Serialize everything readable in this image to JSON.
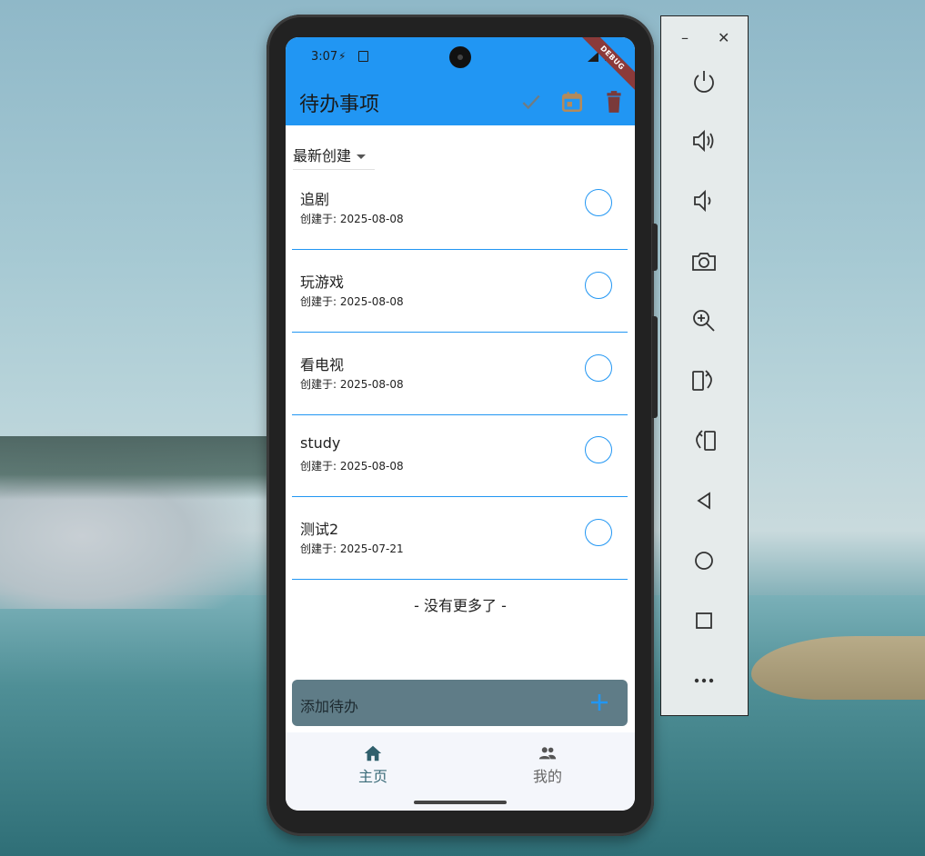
{
  "status": {
    "time": "3:07"
  },
  "debug_banner": "DEBUG",
  "appbar": {
    "title": "待办事项",
    "actions": [
      {
        "name": "check-icon",
        "color": "#6f7c83"
      },
      {
        "name": "calendar-icon",
        "color": "#b48a5a"
      },
      {
        "name": "trash-icon",
        "color": "#7a3a3a"
      }
    ]
  },
  "sort": {
    "selected": "最新创建"
  },
  "todos": [
    {
      "title": "追剧",
      "date": "创建于: 2025-08-08"
    },
    {
      "title": "玩游戏",
      "date": "创建于: 2025-08-08"
    },
    {
      "title": "看电视",
      "date": "创建于: 2025-08-08"
    },
    {
      "title": "study",
      "date": "创建于: 2025-08-08"
    },
    {
      "title": "测试2",
      "date": "创建于: 2025-07-21"
    }
  ],
  "list_footer": "- 没有更多了 -",
  "add_bar": {
    "label": "添加待办"
  },
  "bottom_nav": {
    "items": [
      {
        "label": "主页",
        "icon": "home-icon",
        "active": true,
        "color": "#3a6b78"
      },
      {
        "label": "我的",
        "icon": "people-icon",
        "active": false,
        "color": "#666666"
      }
    ]
  },
  "emulator_panel": {
    "buttons": [
      "minimize-icon",
      "close-icon",
      "power-icon",
      "volume-up-icon",
      "volume-down-icon",
      "camera-icon",
      "zoom-icon",
      "rotate-right-icon",
      "rotate-left-icon",
      "back-icon",
      "home-icon",
      "overview-icon",
      "more-icon"
    ]
  },
  "colors": {
    "primary": "#2196f3",
    "add_bar": "#5f7c87"
  }
}
